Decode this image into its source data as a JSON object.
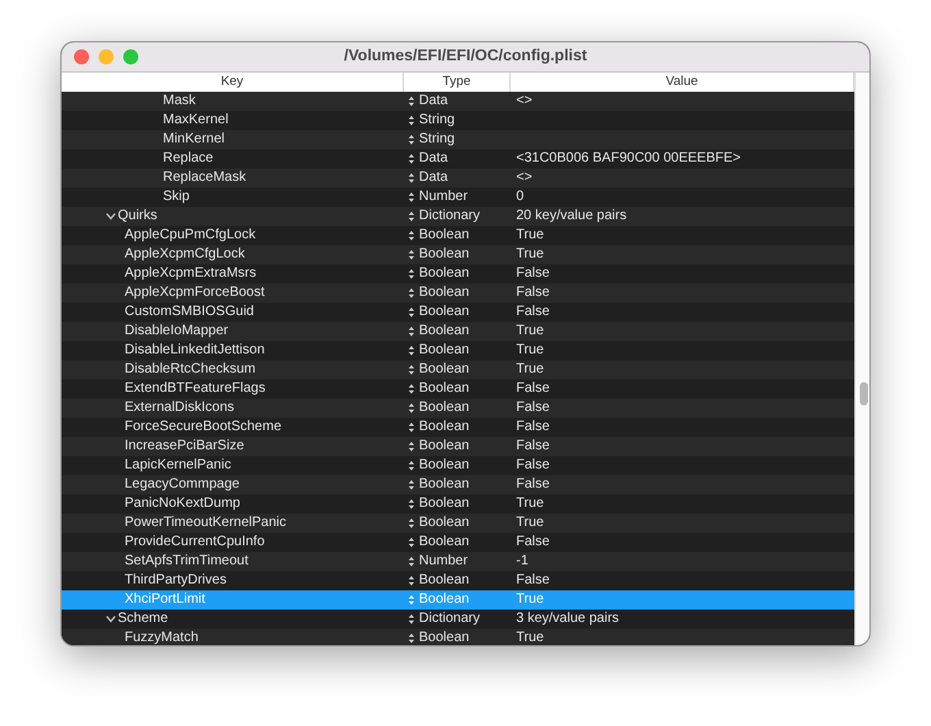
{
  "window": {
    "title": "/Volumes/EFI/EFI/OC/config.plist"
  },
  "table": {
    "columns": [
      "Key",
      "Type",
      "Value"
    ],
    "continued_rows": [
      {
        "key": "Mask",
        "type": "Data",
        "value": "<>",
        "selected": false
      },
      {
        "key": "MaxKernel",
        "type": "String",
        "value": null,
        "selected": false
      },
      {
        "key": "MinKernel",
        "type": "String",
        "value": null,
        "selected": false
      },
      {
        "key": "Replace",
        "type": "Data",
        "value": "<31C0B006 BAF90C00 00EEEBFE>",
        "selected": false
      },
      {
        "key": "ReplaceMask",
        "type": "Data",
        "value": "<>",
        "selected": false
      },
      {
        "key": "Skip",
        "type": "Number",
        "value": "0",
        "selected": false
      }
    ],
    "rows": [
      {
        "key": "Quirks",
        "type": "Dictionary",
        "value": "20 key/value pairs",
        "selected": false,
        "expanded": true,
        "children": [
          {
            "key": "AppleCpuPmCfgLock",
            "type": "Boolean",
            "value": "True",
            "selected": false
          },
          {
            "key": "AppleXcpmCfgLock",
            "type": "Boolean",
            "value": "True",
            "selected": false
          },
          {
            "key": "AppleXcpmExtraMsrs",
            "type": "Boolean",
            "value": "False",
            "selected": false
          },
          {
            "key": "AppleXcpmForceBoost",
            "type": "Boolean",
            "value": "False",
            "selected": false
          },
          {
            "key": "CustomSMBIOSGuid",
            "type": "Boolean",
            "value": "False",
            "selected": false
          },
          {
            "key": "DisableIoMapper",
            "type": "Boolean",
            "value": "True",
            "selected": false
          },
          {
            "key": "DisableLinkeditJettison",
            "type": "Boolean",
            "value": "True",
            "selected": false
          },
          {
            "key": "DisableRtcChecksum",
            "type": "Boolean",
            "value": "True",
            "selected": false
          },
          {
            "key": "ExtendBTFeatureFlags",
            "type": "Boolean",
            "value": "False",
            "selected": false
          },
          {
            "key": "ExternalDiskIcons",
            "type": "Boolean",
            "value": "False",
            "selected": false
          },
          {
            "key": "ForceSecureBootScheme",
            "type": "Boolean",
            "value": "False",
            "selected": false
          },
          {
            "key": "IncreasePciBarSize",
            "type": "Boolean",
            "value": "False",
            "selected": false
          },
          {
            "key": "LapicKernelPanic",
            "type": "Boolean",
            "value": "False",
            "selected": false
          },
          {
            "key": "LegacyCommpage",
            "type": "Boolean",
            "value": "False",
            "selected": false
          },
          {
            "key": "PanicNoKextDump",
            "type": "Boolean",
            "value": "True",
            "selected": false
          },
          {
            "key": "PowerTimeoutKernelPanic",
            "type": "Boolean",
            "value": "True",
            "selected": false
          },
          {
            "key": "ProvideCurrentCpuInfo",
            "type": "Boolean",
            "value": "False",
            "selected": false
          },
          {
            "key": "SetApfsTrimTimeout",
            "type": "Number",
            "value": "-1",
            "selected": false
          },
          {
            "key": "ThirdPartyDrives",
            "type": "Boolean",
            "value": "False",
            "selected": false
          },
          {
            "key": "XhciPortLimit",
            "type": "Boolean",
            "value": "True",
            "selected": true
          }
        ]
      },
      {
        "key": "Scheme",
        "type": "Dictionary",
        "value": "3 key/value pairs",
        "selected": false,
        "expanded": true,
        "children": [
          {
            "key": "FuzzyMatch",
            "type": "Boolean",
            "value": "True",
            "selected": false
          }
        ]
      }
    ]
  }
}
